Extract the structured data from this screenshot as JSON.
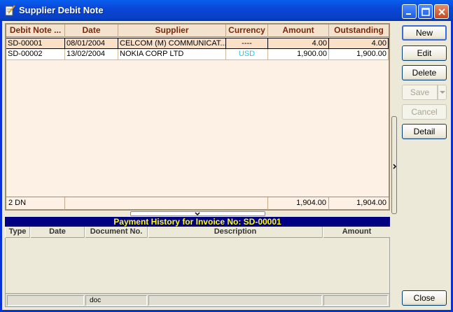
{
  "window": {
    "title": "Supplier Debit Note",
    "accent": "#0a46d6"
  },
  "grid": {
    "columns": [
      "Debit Note ...",
      "Date",
      "Supplier",
      "Currency",
      "Amount",
      "Outstanding"
    ],
    "rows": [
      {
        "debit_note": "SD-00001",
        "date": "08/01/2004",
        "supplier": "CELCOM (M) COMMUNICAT...",
        "currency": "----",
        "amount": "4.00",
        "outstanding": "4.00"
      },
      {
        "debit_note": "SD-00002",
        "date": "13/02/2004",
        "supplier": "NOKIA CORP LTD",
        "currency": "USD",
        "amount": "1,900.00",
        "outstanding": "1,900.00"
      }
    ],
    "footer": {
      "count": "2 DN",
      "amount_total": "1,904.00",
      "outstanding_total": "1,904.00"
    }
  },
  "payment_history": {
    "title": "Payment History for Invoice No: SD-00001",
    "columns": [
      "Type",
      "Date",
      "Document No.",
      "Description",
      "Amount"
    ],
    "status": {
      "doc": "doc"
    }
  },
  "buttons": {
    "new": "New",
    "edit": "Edit",
    "delete": "Delete",
    "save": "Save",
    "cancel": "Cancel",
    "detail": "Detail",
    "close": "Close"
  }
}
